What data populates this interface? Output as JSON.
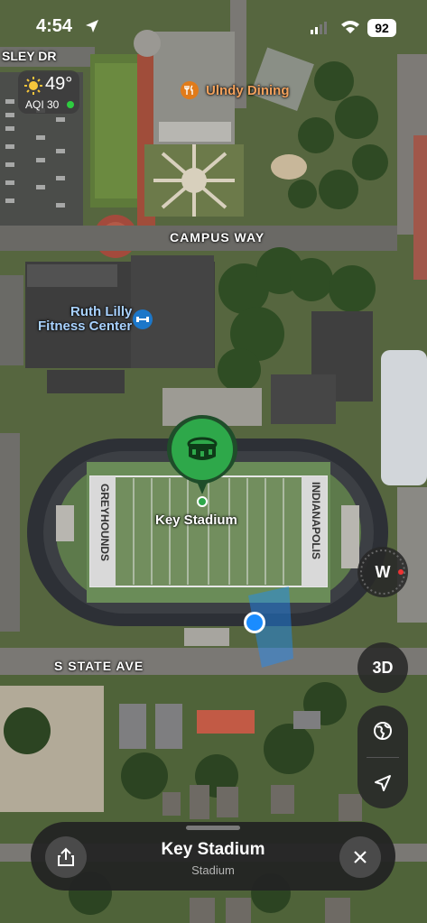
{
  "status": {
    "time": "4:54",
    "battery": "92"
  },
  "weather": {
    "temperature": "49°",
    "aqi": "AQI 30",
    "icon": "sun-icon"
  },
  "map_labels": {
    "street_top": "SLEY DR",
    "dining": "Ulndy Dining",
    "campus_way": "CAMPUS WAY",
    "fitness_line1": "Ruth Lilly",
    "fitness_line2": "Fitness Center",
    "stadium": "Key Stadium",
    "field_left": "GREYHOUNDS",
    "field_right": "INDIANAPOLIS",
    "state_ave": "S STATE AVE"
  },
  "controls": {
    "compass": "W",
    "three_d": "3D"
  },
  "sheet": {
    "title": "Key Stadium",
    "subtitle": "Stadium"
  },
  "colors": {
    "user_location": "#1a8cff",
    "stadium_pin": "#2ea84a",
    "dining_icon": "#e07b1a",
    "fitness_icon": "#1c77c9"
  }
}
